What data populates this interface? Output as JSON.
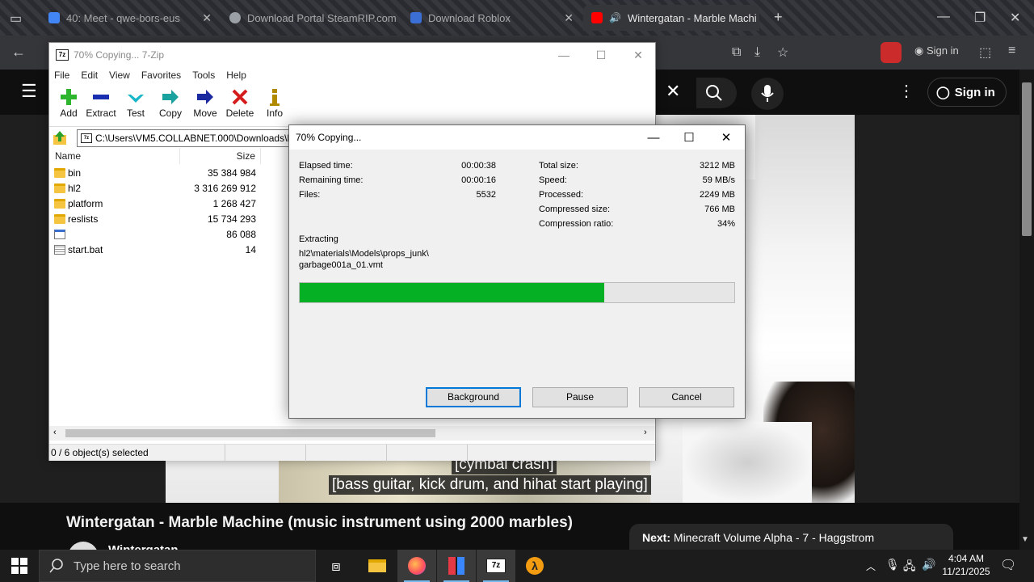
{
  "browser": {
    "tabs": [
      {
        "title": "40: Meet - qwe-bors-eus",
        "color": "#4285f4"
      },
      {
        "title": "Download Portal SteamRIP.com",
        "color": "#9aa0a6"
      },
      {
        "title": "Download Roblox",
        "color": "#3b6fd6"
      },
      {
        "title": "Wintergatan - Marble Machi",
        "color": "#ff0000"
      }
    ],
    "new_tab": "+",
    "sign_in_small": "Sign in"
  },
  "youtube": {
    "sign_in": "Sign in",
    "captions": [
      "[cymbal crash]",
      "[bass guitar, kick drum, and hihat start playing]"
    ],
    "video_title": "Wintergatan - Marble Machine (music instrument using 2000 marbles)",
    "channel": "Wintergatan",
    "next_label": "Next:",
    "next_title": "Minecraft Volume Alpha - 7 - Haggstrom"
  },
  "zip": {
    "title": "70% Copying... 7-Zip",
    "app_icon": "7z",
    "menu": [
      "File",
      "Edit",
      "View",
      "Favorites",
      "Tools",
      "Help"
    ],
    "toolbar": [
      {
        "label": "Add",
        "icon": "plus-icon"
      },
      {
        "label": "Extract",
        "icon": "minus-icon"
      },
      {
        "label": "Test",
        "icon": "check-arrow-icon"
      },
      {
        "label": "Copy",
        "icon": "copy-arrow-icon"
      },
      {
        "label": "Move",
        "icon": "move-arrow-icon"
      },
      {
        "label": "Delete",
        "icon": "x-icon"
      },
      {
        "label": "Info",
        "icon": "info-icon"
      }
    ],
    "address": "C:\\Users\\VM5.COLLABNET.000\\Downloads\\H",
    "columns": {
      "name": "Name",
      "size": "Size"
    },
    "files": [
      {
        "name": "bin",
        "size": "35 384 984",
        "type": "folder"
      },
      {
        "name": "hl2",
        "size": "3 316 269 912",
        "type": "folder"
      },
      {
        "name": "platform",
        "size": "1 268 427",
        "type": "folder"
      },
      {
        "name": "reslists",
        "size": "15 734 293",
        "type": "folder"
      },
      {
        "name": "",
        "size": "86 088",
        "type": "exe"
      },
      {
        "name": "start.bat",
        "size": "14",
        "type": "bat"
      }
    ],
    "status": "0 / 6 object(s) selected"
  },
  "dialog": {
    "title": "70% Copying...",
    "left_stats": [
      {
        "label": "Elapsed time:",
        "value": "00:00:38"
      },
      {
        "label": "Remaining time:",
        "value": "00:00:16"
      },
      {
        "label": "Files:",
        "value": "5532"
      }
    ],
    "right_stats": [
      {
        "label": "Total size:",
        "value": "3212 MB"
      },
      {
        "label": "Speed:",
        "value": "59 MB/s"
      },
      {
        "label": "Processed:",
        "value": "2249 MB"
      },
      {
        "label": "Compressed size:",
        "value": "766 MB"
      },
      {
        "label": "Compression ratio:",
        "value": "34%"
      }
    ],
    "action": "Extracting",
    "current_path_1": "hl2\\materials\\Models\\props_junk\\",
    "current_path_2": "garbage001a_01.vmt",
    "progress": 0.7,
    "buttons": {
      "background": "Background",
      "pause": "Pause",
      "cancel": "Cancel"
    }
  },
  "taskbar": {
    "search_placeholder": "Type here to search",
    "time": "4:04 AM",
    "date": "11/21/2025"
  }
}
